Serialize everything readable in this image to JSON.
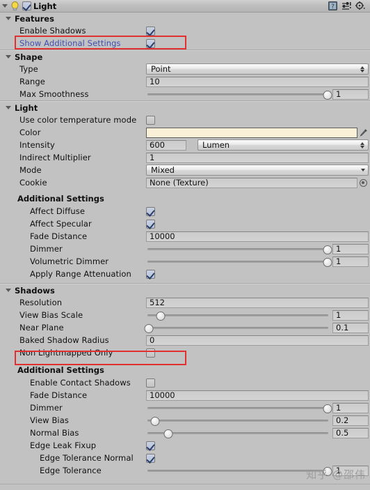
{
  "header": {
    "title": "Light",
    "enabled": true,
    "icons": [
      "bulb-icon",
      "help-book-icon",
      "preset-icon",
      "gear-icon"
    ]
  },
  "colors": {
    "light_color_swatch": "#faf0d7",
    "annotation_red": "#e03030",
    "link_blue": "#3f4fb0",
    "panel_bg": "#c2c2c2"
  },
  "sections": {
    "features": {
      "label": "Features",
      "rows": {
        "enable_shadows": {
          "label": "Enable Shadows",
          "value": true
        },
        "show_additional_settings": {
          "label": "Show Additional Settings",
          "value": true
        }
      }
    },
    "shape": {
      "label": "Shape",
      "rows": {
        "type": {
          "label": "Type",
          "value": "Point"
        },
        "range": {
          "label": "Range",
          "value": "10"
        },
        "max_smoothness": {
          "label": "Max Smoothness",
          "value": "1",
          "slider_pct": 99
        }
      }
    },
    "light": {
      "label": "Light",
      "rows": {
        "use_color_temperature_mode": {
          "label": "Use color temperature mode",
          "value": false
        },
        "color": {
          "label": "Color",
          "value": "#faf0d7"
        },
        "intensity": {
          "label": "Intensity",
          "value": "600",
          "unit": "Lumen"
        },
        "indirect_multiplier": {
          "label": "Indirect Multiplier",
          "value": "1"
        },
        "mode": {
          "label": "Mode",
          "value": "Mixed"
        },
        "cookie": {
          "label": "Cookie",
          "value": "None (Texture)"
        }
      },
      "additional": {
        "label": "Additional Settings",
        "rows": {
          "affect_diffuse": {
            "label": "Affect Diffuse",
            "value": true
          },
          "affect_specular": {
            "label": "Affect Specular",
            "value": true
          },
          "fade_distance": {
            "label": "Fade Distance",
            "value": "10000"
          },
          "dimmer": {
            "label": "Dimmer",
            "value": "1",
            "slider_pct": 99
          },
          "volumetric_dimmer": {
            "label": "Volumetric Dimmer",
            "value": "1",
            "slider_pct": 99
          },
          "apply_range_attenuation": {
            "label": "Apply Range Attenuation",
            "value": true
          }
        }
      }
    },
    "shadows": {
      "label": "Shadows",
      "rows": {
        "resolution": {
          "label": "Resolution",
          "value": "512"
        },
        "view_bias_scale": {
          "label": "View Bias Scale",
          "value": "1",
          "slider_pct": 8
        },
        "near_plane": {
          "label": "Near Plane",
          "value": "0.1",
          "slider_pct": 1
        },
        "baked_shadow_radius": {
          "label": "Baked Shadow Radius",
          "value": "0"
        },
        "non_lightmapped_only": {
          "label": "Non Lightmapped Only",
          "value": false
        }
      },
      "additional": {
        "label": "Additional Settings",
        "rows": {
          "enable_contact_shadows": {
            "label": "Enable Contact Shadows",
            "value": false
          },
          "fade_distance": {
            "label": "Fade Distance",
            "value": "10000"
          },
          "dimmer": {
            "label": "Dimmer",
            "value": "1",
            "slider_pct": 99
          },
          "view_bias": {
            "label": "View Bias",
            "value": "0.2",
            "slider_pct": 5
          },
          "normal_bias": {
            "label": "Normal Bias",
            "value": "0.5",
            "slider_pct": 12
          },
          "edge_leak_fixup": {
            "label": "Edge Leak Fixup",
            "value": true
          },
          "edge_tolerance_normal": {
            "label": "Edge Tolerance Normal",
            "value": true
          },
          "edge_tolerance": {
            "label": "Edge Tolerance",
            "value": "1",
            "slider_pct": 99
          }
        }
      }
    }
  },
  "watermark": {
    "text": "知乎 @邵伟"
  }
}
